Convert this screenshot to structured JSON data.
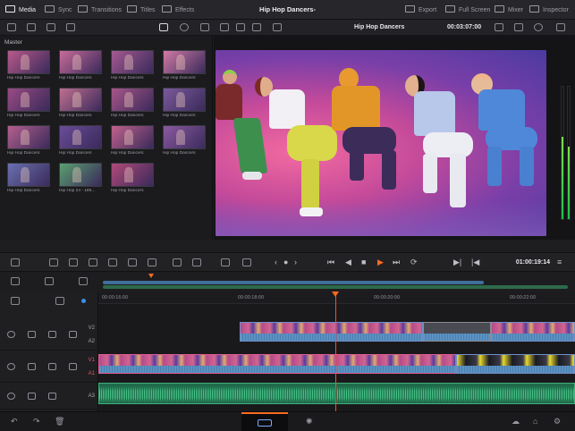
{
  "topbar": {
    "media": "Media",
    "sync": "Sync",
    "transitions": "Transitions",
    "titles": "Titles",
    "effects": "Effects",
    "project_title": "Hip Hop Dancers-",
    "export": "Export",
    "full_screen": "Full Screen",
    "mixer": "Mixer",
    "inspector": "Inspector"
  },
  "viewer_bar": {
    "clip_name": "Hip Hop Dancers",
    "timecode": "00:03:07:00"
  },
  "media_pool": {
    "label": "Master",
    "clips": [
      {
        "name": "Hip Hop Dancers",
        "color": "#b85a8a"
      },
      {
        "name": "Hip Hop Dancers",
        "color": "#c86b9a"
      },
      {
        "name": "Hip Hop Dancers",
        "color": "#a45a92"
      },
      {
        "name": "Hip Hop Dancers",
        "color": "#d07aa4"
      },
      {
        "name": "Hip Hop Dancers",
        "color": "#9a4a84"
      },
      {
        "name": "Hip Hop Dancers",
        "color": "#c06f90"
      },
      {
        "name": "Hip Hop Dancers",
        "color": "#a85688"
      },
      {
        "name": "Hip Hop Dancers",
        "color": "#7a5a9a"
      },
      {
        "name": "Hip Hop Dancers",
        "color": "#b4608e"
      },
      {
        "name": "Hip Hop Dancers",
        "color": "#6a4c98"
      },
      {
        "name": "Hip Hop Dancers",
        "color": "#c0628c"
      },
      {
        "name": "Hip Hop Dancers",
        "color": "#8a5aa0"
      },
      {
        "name": "Hip Hop Dancers",
        "color": "#6a70b0"
      },
      {
        "name": "Hip Hop 24 - 186...",
        "color": "#5aa070"
      },
      {
        "name": "Hip Hop Dancers",
        "color": "#b04a7a"
      }
    ]
  },
  "timeline": {
    "timecode": "01:00:19:14",
    "ruler": [
      "00:00:16:00",
      "00:00:18:00",
      "00:00:20:00",
      "00:00:22:00"
    ],
    "tracks": [
      "V2",
      "V1",
      "A3"
    ],
    "track_a2": "A2",
    "track_a1": "A1"
  },
  "colors": {
    "accent": "#ff6a1f",
    "playhead": "#ff4a2a",
    "video_clip": "#2c4c7a",
    "audio_clip": "#1f6b4b"
  },
  "meters": {
    "left_level": 0.62,
    "right_level": 0.55
  }
}
